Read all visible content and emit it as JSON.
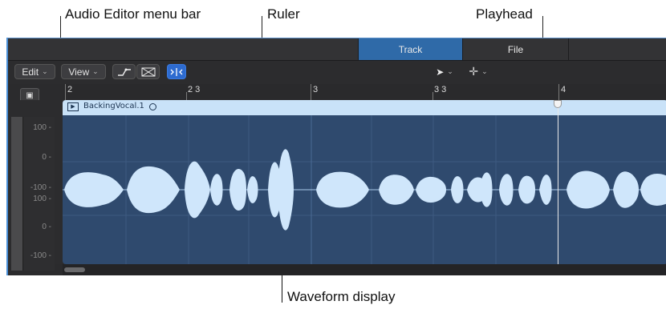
{
  "callouts": {
    "menu_bar": "Audio Editor menu bar",
    "ruler": "Ruler",
    "playhead": "Playhead",
    "waveform": "Waveform display"
  },
  "tabs": [
    {
      "label": "Track",
      "active": true
    },
    {
      "label": "File",
      "active": false
    }
  ],
  "toolbar": {
    "edit_menu": "Edit",
    "view_menu": "View",
    "chevron": "⌵",
    "icons": [
      "curve-tool-icon",
      "crossfade-icon",
      "catch-playhead-icon",
      "pointer-tool-icon",
      "crosshair-tool-icon"
    ]
  },
  "ruler": {
    "marks": [
      "2",
      "2 3",
      "3",
      "3 3",
      "4"
    ]
  },
  "region": {
    "name": "BackingVocal.1",
    "color": "#c9e2f8",
    "body_color": "#2f4a6e",
    "waveform_color": "#cfe6fb"
  },
  "scale_labels": [
    "100 -",
    "0 -",
    "-100 -",
    "100 -",
    "0 -",
    "-100 -"
  ],
  "accent": "#2f6aa8"
}
